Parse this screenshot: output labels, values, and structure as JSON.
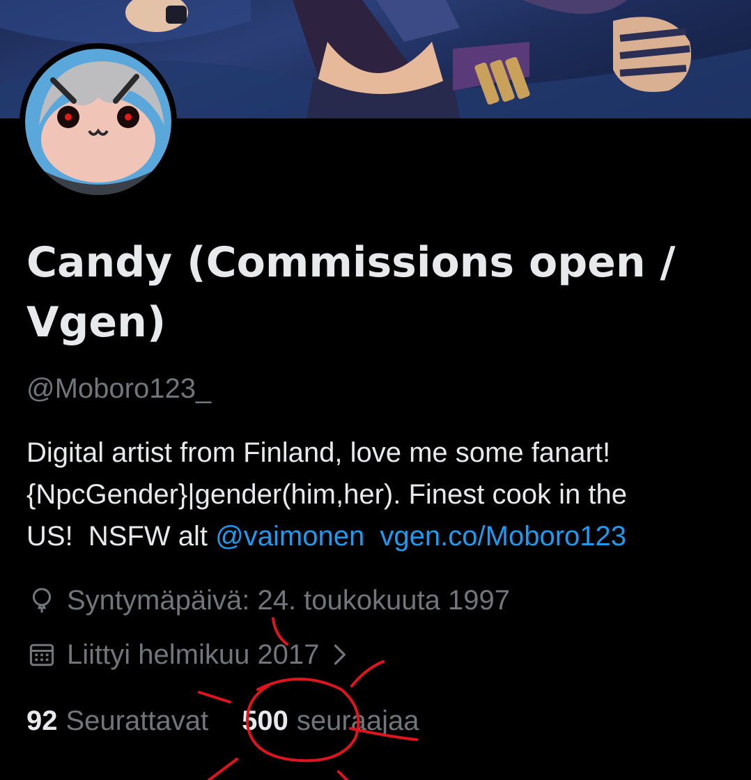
{
  "profile": {
    "display_name": "Candy (Commissions open / Vgen)",
    "handle": "@Moboro123_",
    "bio": {
      "line1": "Digital artist from Finland, love me some fanart!",
      "line2": "{NpcGender}|gender(him,her). Finest cook in the",
      "line3_prefix": "US!  NSFW alt ",
      "mention": "@vaimonen",
      "link": "vgen.co/Moboro123"
    },
    "birthday": "Syntymäpäivä: 24. toukokuuta 1997",
    "joined": "Liittyi helmikuu 2017",
    "following_count": "92",
    "following_label": "Seurattavat",
    "followers_count": "500",
    "followers_label": "seuraajaa"
  },
  "icons": {
    "birthday": "balloon-icon",
    "joined": "calendar-icon",
    "joined_more": "chevron-right-icon"
  },
  "colors": {
    "background": "#000000",
    "text": "#e7e9ea",
    "secondary": "#71767b",
    "link": "#1d9bf0",
    "annotation": "#e0141e"
  }
}
